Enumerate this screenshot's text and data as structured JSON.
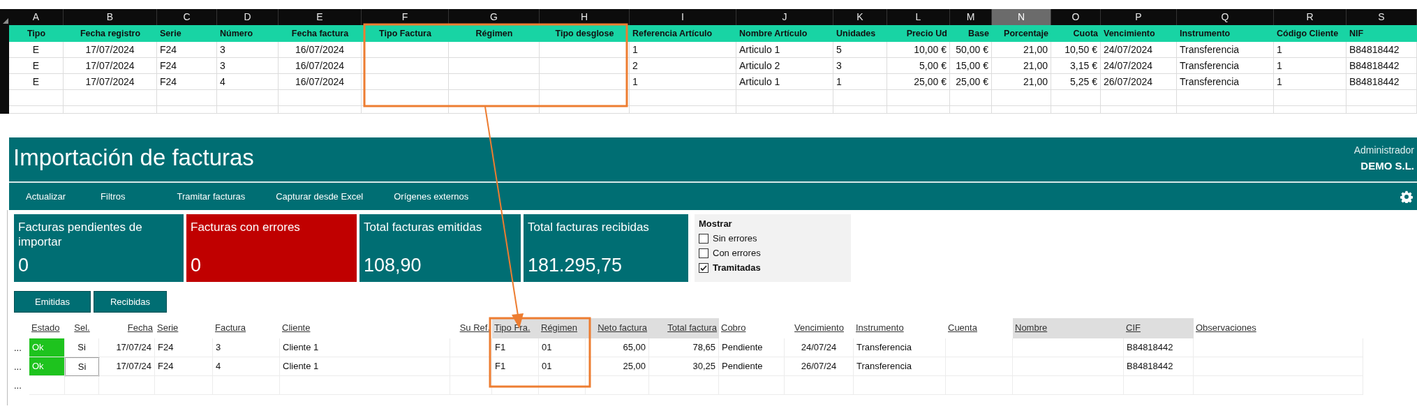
{
  "spreadsheet": {
    "columns": [
      {
        "letter": "A",
        "selected": false
      },
      {
        "letter": "B",
        "selected": false
      },
      {
        "letter": "C",
        "selected": false
      },
      {
        "letter": "D",
        "selected": false
      },
      {
        "letter": "E",
        "selected": false
      },
      {
        "letter": "F",
        "selected": false
      },
      {
        "letter": "G",
        "selected": false
      },
      {
        "letter": "H",
        "selected": false
      },
      {
        "letter": "I",
        "selected": false
      },
      {
        "letter": "J",
        "selected": false
      },
      {
        "letter": "K",
        "selected": false
      },
      {
        "letter": "L",
        "selected": false
      },
      {
        "letter": "M",
        "selected": false
      },
      {
        "letter": "N",
        "selected": true
      },
      {
        "letter": "O",
        "selected": false
      },
      {
        "letter": "P",
        "selected": false
      },
      {
        "letter": "Q",
        "selected": false
      },
      {
        "letter": "R",
        "selected": false
      },
      {
        "letter": "S",
        "selected": false
      }
    ],
    "header": [
      "Tipo",
      "Fecha registro",
      "Serie",
      "Número",
      "Fecha factura",
      "Tipo Factura",
      "Régimen",
      "Tipo desglose",
      "Referencia Artículo",
      "Nombre Artículo",
      "Unidades",
      "Precio Ud",
      "Base",
      "Porcentaje",
      "Cuota",
      "Vencimiento",
      "Instrumento",
      "Código Cliente",
      "NIF"
    ],
    "rows": [
      [
        "E",
        "17/07/2024",
        "F24",
        "3",
        "16/07/2024",
        null,
        null,
        null,
        "1",
        "Articulo 1",
        "5",
        "10,00 €",
        "50,00 €",
        "21,00",
        "10,50 €",
        "24/07/2024",
        "Transferencia",
        "1",
        "B84818442"
      ],
      [
        "E",
        "17/07/2024",
        "F24",
        "3",
        "16/07/2024",
        null,
        null,
        null,
        "2",
        "Articulo 2",
        "3",
        "5,00 €",
        "15,00 €",
        "21,00",
        "3,15 €",
        "24/07/2024",
        "Transferencia",
        "1",
        "B84818442"
      ],
      [
        "E",
        "17/07/2024",
        "F24",
        "4",
        "16/07/2024",
        null,
        null,
        null,
        "1",
        "Articulo 1",
        "1",
        "25,00 €",
        "25,00 €",
        "21,00",
        "5,25 €",
        "26/07/2024",
        "Transferencia",
        "1",
        "B84818442"
      ]
    ]
  },
  "app": {
    "title": "Importación de facturas",
    "user": "Administrador",
    "company": "DEMO S.L.",
    "toolbar": [
      "Actualizar",
      "Filtros",
      "Tramitar facturas",
      "Capturar desde Excel",
      "Orígenes externos"
    ],
    "tiles": [
      {
        "label": "Facturas pendientes de importar",
        "value": "0",
        "kind": "normal"
      },
      {
        "label": "Facturas con errores",
        "value": "0",
        "kind": "error"
      },
      {
        "label": "Total facturas emitidas",
        "value": "108,90",
        "kind": "normal"
      },
      {
        "label": "Total facturas recibidas",
        "value": "181.295,75",
        "kind": "normal"
      }
    ],
    "filter": {
      "title": "Mostrar",
      "options": [
        {
          "label": "Sin errores",
          "checked": false
        },
        {
          "label": "Con errores",
          "checked": false
        },
        {
          "label": "Tramitadas",
          "checked": true
        }
      ]
    },
    "buttons": [
      "Emitidas",
      "Recibidas"
    ],
    "table": {
      "columns": [
        {
          "label": "Estado",
          "shaded": false
        },
        {
          "label": "Sel.",
          "shaded": false
        },
        {
          "label": "Fecha",
          "shaded": false
        },
        {
          "label": "Serie",
          "shaded": false
        },
        {
          "label": "Factura",
          "shaded": false
        },
        {
          "label": "Cliente",
          "shaded": false
        },
        {
          "label": "Su Ref.",
          "shaded": false
        },
        {
          "label": "Tipo Fra.",
          "shaded": true
        },
        {
          "label": "Régimen",
          "shaded": true
        },
        {
          "label": "Neto factura",
          "shaded": true
        },
        {
          "label": "Total factura",
          "shaded": true
        },
        {
          "label": "Cobro",
          "shaded": false
        },
        {
          "label": "Vencimiento",
          "shaded": false
        },
        {
          "label": "Instrumento",
          "shaded": false
        },
        {
          "label": "Cuenta",
          "shaded": false
        },
        {
          "label": "Nombre",
          "shaded": true
        },
        {
          "label": "CIF",
          "shaded": true
        },
        {
          "label": "Observaciones",
          "shaded": false
        }
      ],
      "rows": [
        {
          "marker": "...",
          "color": "#1ec31e",
          "focused": false,
          "cells": [
            "Ok",
            "Si",
            "17/07/24",
            "F24",
            "3",
            "Cliente 1",
            null,
            "F1",
            "01",
            "65,00",
            "78,65",
            "Pendiente",
            "24/07/24",
            "Transferencia",
            null,
            null,
            "B84818442",
            null
          ]
        },
        {
          "marker": "...",
          "color": "#1ec31e",
          "focused": true,
          "cells": [
            "Ok",
            "Si",
            "17/07/24",
            "F24",
            "4",
            "Cliente 1",
            null,
            "F1",
            "01",
            "25,00",
            "30,25",
            "Pendiente",
            "26/07/24",
            "Transferencia",
            null,
            null,
            "B84818442",
            null
          ]
        },
        {
          "marker": "..."
        }
      ]
    }
  }
}
